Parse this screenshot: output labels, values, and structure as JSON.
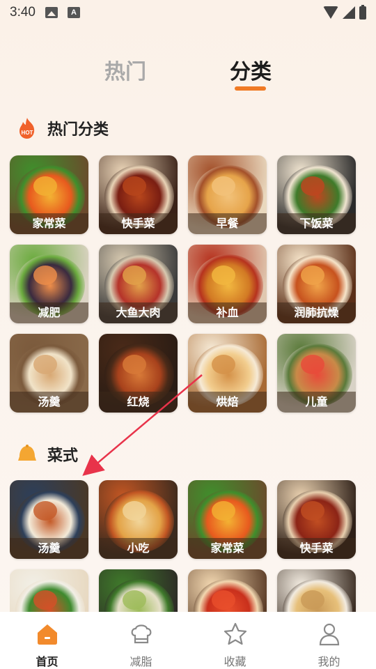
{
  "status_bar": {
    "time": "3:40",
    "icons": [
      "image-icon",
      "a-icon",
      "wifi-icon",
      "signal-icon",
      "battery-icon"
    ]
  },
  "top_tabs": {
    "hot": "热门",
    "category": "分类",
    "active": "分类",
    "accent_color": "#f07a24"
  },
  "popular_section": {
    "title": "热门分类",
    "icon": "hot-fire-icon",
    "icon_text": "HOT",
    "items": [
      {
        "label": "家常菜"
      },
      {
        "label": "快手菜"
      },
      {
        "label": "早餐"
      },
      {
        "label": "下饭菜"
      },
      {
        "label": "减肥"
      },
      {
        "label": "大鱼大肉"
      },
      {
        "label": "补血"
      },
      {
        "label": "润肺抗燥"
      },
      {
        "label": "汤羹"
      },
      {
        "label": "红烧"
      },
      {
        "label": "烘焙"
      },
      {
        "label": "儿童"
      }
    ]
  },
  "cuisine_section": {
    "title": "菜式",
    "icon": "bell-icon",
    "items": [
      {
        "label": "汤羹"
      },
      {
        "label": "小吃"
      },
      {
        "label": "家常菜"
      },
      {
        "label": "快手菜"
      },
      {
        "label": ""
      },
      {
        "label": ""
      },
      {
        "label": ""
      },
      {
        "label": ""
      }
    ]
  },
  "bottom_nav": {
    "items": [
      {
        "label": "首页",
        "icon": "home-icon",
        "active": true
      },
      {
        "label": "减脂",
        "icon": "chef-hat-icon",
        "active": false
      },
      {
        "label": "收藏",
        "icon": "star-icon",
        "active": false
      },
      {
        "label": "我的",
        "icon": "person-icon",
        "active": false
      }
    ]
  }
}
